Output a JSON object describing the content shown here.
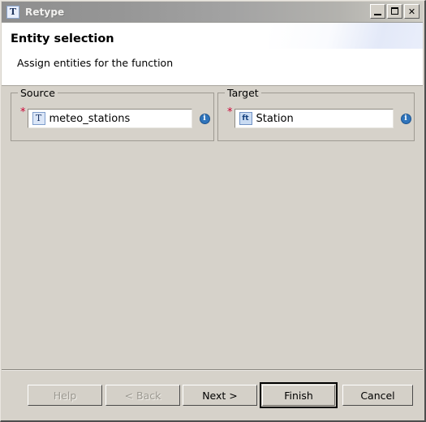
{
  "window": {
    "title": "Retype",
    "title_icon": "type-t-icon",
    "controls": {
      "minimize": "minimize-icon",
      "maximize": "maximize-icon",
      "close": "✕"
    }
  },
  "header": {
    "title": "Entity selection",
    "subtitle": "Assign entities for the function"
  },
  "content": {
    "groups": [
      {
        "legend": "Source",
        "required_marker": "*",
        "field": {
          "icon_label": "T",
          "icon_name": "type-t-icon",
          "value": "meteo_stations",
          "placeholder": ""
        },
        "info": "i"
      },
      {
        "legend": "Target",
        "required_marker": "*",
        "field": {
          "icon_label": "ft",
          "icon_name": "feature-type-icon",
          "value": "Station",
          "placeholder": ""
        },
        "info": "i"
      }
    ]
  },
  "buttons": [
    {
      "label": "Help",
      "enabled": false,
      "default": false
    },
    {
      "label": "< Back",
      "enabled": false,
      "default": false
    },
    {
      "label": "Next >",
      "enabled": true,
      "default": false
    },
    {
      "label": "Finish",
      "enabled": true,
      "default": true
    },
    {
      "label": "Cancel",
      "enabled": true,
      "default": false
    }
  ],
  "colors": {
    "dialog_bg": "#d6d2ca",
    "header_bg": "#ffffff",
    "accent_blue": "#2f74bb",
    "required_red": "#cc0033"
  }
}
